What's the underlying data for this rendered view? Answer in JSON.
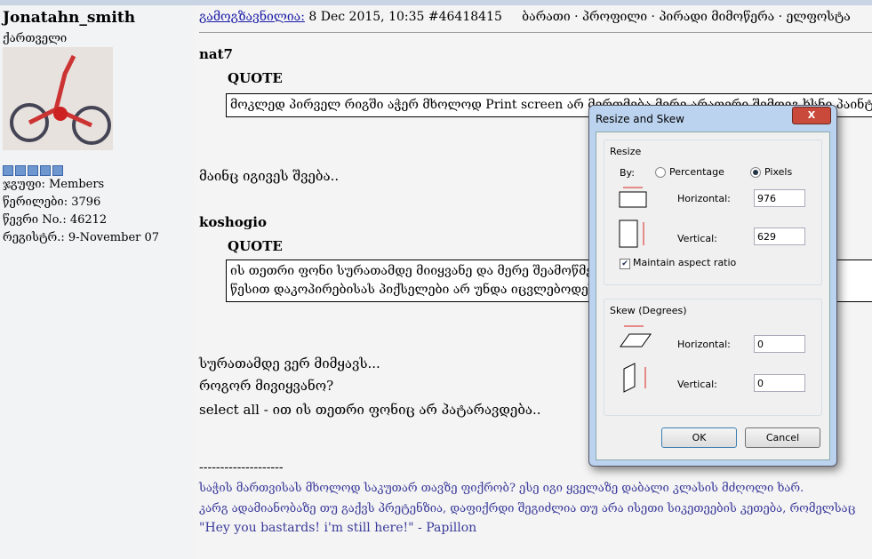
{
  "user": {
    "name": "Jonatahn_smith",
    "location": "ქართველი",
    "group": "ჯგუფი: Members",
    "posts": "წერილები: 3796",
    "member_no": "წევრი No.: 46212",
    "registered": "რეგისტრ.: 9-November 07"
  },
  "post": {
    "sent_label": "გამოგზავნილია:",
    "date": " 8 Dec 2015, 10:35  #46418415",
    "actions": "ბარათი · პროფილი · პირადი მიმოწერა · ელფოსტა",
    "quote1_author": "nat7",
    "quote_label": "QUOTE",
    "quote1_text": "მოკლედ პირველ რიგში აჭერ მხოლოდ Print screen არ მერთმება მერე არაფერი შემდეგ ხსნი პაინტს",
    "reply1": "მაინც იგივეს შვება..",
    "quote2_author": "koshogio",
    "quote2_line1": "ის თეთრი ფონი სურათამდე მიიყვანე და მერე შეამოწმე",
    "quote2_line2": "წესით დაკოპირებისას პიქსელები არ უნდა იცვლებოდეს",
    "reply2": [
      "სურათამდე ვერ მიმყავს...",
      "როგორ მივიყვანო?",
      "select all - ით ის თეთრი ფონიც არ პატარავდება.."
    ],
    "sig_sep": "--------------------",
    "sig": [
      "საჭის მართვისას მხოლოდ საკუთარ თავზე ფიქრობ? ესე იგი ყველაზე დაბალი კლასის მძღოლი ხარ.",
      "კარგ ადამიანობაზე თუ გაქვს პრეტენზია, დაფიქრდი შეგიძლია თუ არა ისეთი სიკეთეების კეთება, რომელსაც",
      "\"Hey you bastards! i'm still here!\" - Papillon"
    ]
  },
  "dialog": {
    "title": "Resize and Skew",
    "close": "X",
    "resize": "Resize",
    "by": "By:",
    "percentage": "Percentage",
    "pixels": "Pixels",
    "horizontal": "Horizontal:",
    "vertical": "Vertical:",
    "h_value": "976",
    "v_value": "629",
    "maintain": "Maintain aspect ratio",
    "skew": "Skew (Degrees)",
    "skew_h": "0",
    "skew_v": "0",
    "ok": "OK",
    "cancel": "Cancel"
  }
}
